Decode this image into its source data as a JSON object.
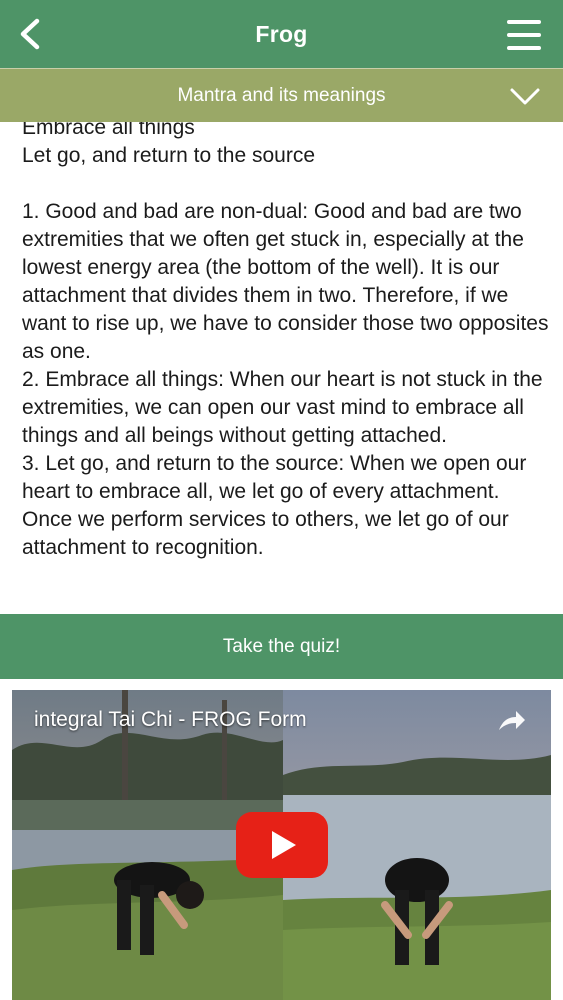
{
  "header": {
    "title": "Frog",
    "back_icon": "chevron-left-icon",
    "menu_icon": "hamburger-menu-icon"
  },
  "section": {
    "label": "Mantra and its meanings",
    "toggle_icon": "chevron-down-icon"
  },
  "body": {
    "lines": [
      "Embrace all things",
      "Let go, and return to the source"
    ],
    "points": [
      "1. Good and bad are non-dual: Good and bad are two extremities that we often get stuck in, especially at the lowest energy area (the bottom of the well). It is our attachment that divides them in two. Therefore, if we want to rise up, we have to consider those two opposites as one.",
      "2. Embrace all things: When our heart is not stuck in the extremities, we can open our vast mind to embrace all things and all beings without getting attached.",
      "3. Let go, and return to the source: When we open our heart to embrace all, we let go of every attachment. Once we perform services to others, we let go of our attachment to recognition."
    ]
  },
  "quiz": {
    "label": "Take the quiz!"
  },
  "video": {
    "title": "integral Tai Chi - FROG Form",
    "share_icon": "share-icon",
    "play_icon": "youtube-play-icon"
  },
  "colors": {
    "primary": "#4e9467",
    "secondary": "#9aa867",
    "text": "#1b1b1b",
    "play": "#e62117"
  }
}
